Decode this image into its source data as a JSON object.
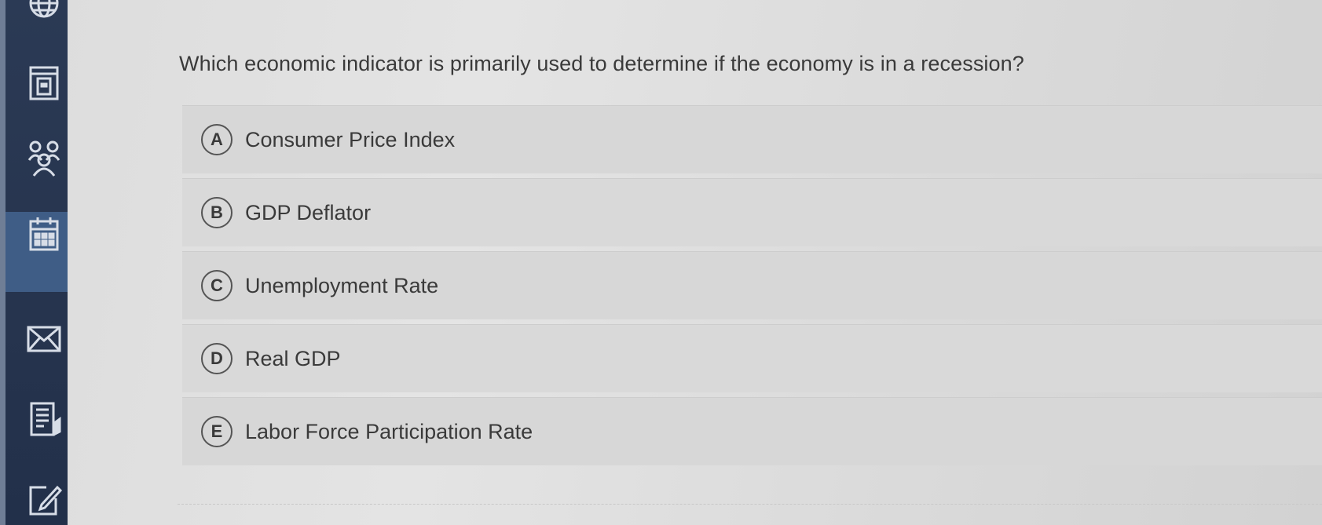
{
  "sidebar": {
    "icons": [
      {
        "name": "globe-icon"
      },
      {
        "name": "dashboard-icon"
      },
      {
        "name": "people-icon"
      },
      {
        "name": "calendar-icon",
        "active": true
      },
      {
        "name": "mail-icon"
      },
      {
        "name": "document-icon"
      },
      {
        "name": "edit-icon"
      }
    ],
    "colors": {
      "background": "#2b3a55",
      "active": "#3f5d86",
      "icon": "#d7dde7"
    }
  },
  "question": {
    "text": "Which economic indicator is primarily used to determine if the economy is in a recession?"
  },
  "options": [
    {
      "letter": "A",
      "label": "Consumer Price Index"
    },
    {
      "letter": "B",
      "label": "GDP Deflator"
    },
    {
      "letter": "C",
      "label": "Unemployment Rate"
    },
    {
      "letter": "D",
      "label": "Real GDP"
    },
    {
      "letter": "E",
      "label": "Labor Force Participation Rate"
    }
  ]
}
